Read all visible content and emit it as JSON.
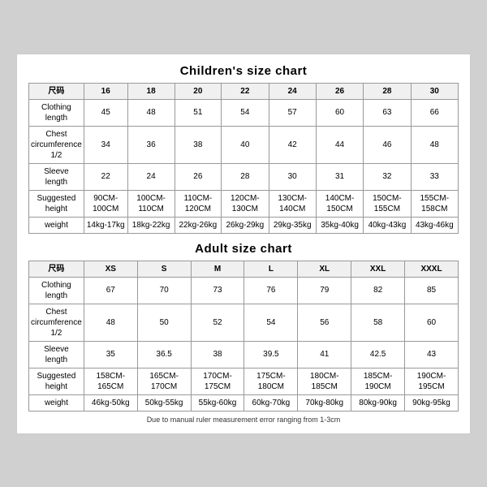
{
  "children_chart": {
    "title": "Children's size chart",
    "headers": [
      "尺码",
      "16",
      "18",
      "20",
      "22",
      "24",
      "26",
      "28",
      "30"
    ],
    "rows": [
      {
        "label": "Clothing\nlength",
        "values": [
          "45",
          "48",
          "51",
          "54",
          "57",
          "60",
          "63",
          "66"
        ]
      },
      {
        "label": "Chest\ncircumference\n1/2",
        "values": [
          "34",
          "36",
          "38",
          "40",
          "42",
          "44",
          "46",
          "48"
        ]
      },
      {
        "label": "Sleeve\nlength",
        "values": [
          "22",
          "24",
          "26",
          "28",
          "30",
          "31",
          "32",
          "33"
        ]
      },
      {
        "label": "Suggested\nheight",
        "values": [
          "90CM-100CM",
          "100CM-110CM",
          "110CM-120CM",
          "120CM-130CM",
          "130CM-140CM",
          "140CM-150CM",
          "150CM-155CM",
          "155CM-158CM"
        ]
      },
      {
        "label": "weight",
        "values": [
          "14kg-17kg",
          "18kg-22kg",
          "22kg-26kg",
          "26kg-29kg",
          "29kg-35kg",
          "35kg-40kg",
          "40kg-43kg",
          "43kg-46kg"
        ]
      }
    ]
  },
  "adult_chart": {
    "title": "Adult size chart",
    "headers": [
      "尺码",
      "XS",
      "S",
      "M",
      "L",
      "XL",
      "XXL",
      "XXXL"
    ],
    "rows": [
      {
        "label": "Clothing\nlength",
        "values": [
          "67",
          "70",
          "73",
          "76",
          "79",
          "82",
          "85"
        ]
      },
      {
        "label": "Chest\ncircumference\n1/2",
        "values": [
          "48",
          "50",
          "52",
          "54",
          "56",
          "58",
          "60"
        ]
      },
      {
        "label": "Sleeve\nlength",
        "values": [
          "35",
          "36.5",
          "38",
          "39.5",
          "41",
          "42.5",
          "43"
        ]
      },
      {
        "label": "Suggested\nheight",
        "values": [
          "158CM-165CM",
          "165CM-170CM",
          "170CM-175CM",
          "175CM-180CM",
          "180CM-185CM",
          "185CM-190CM",
          "190CM-195CM"
        ]
      },
      {
        "label": "weight",
        "values": [
          "46kg-50kg",
          "50kg-55kg",
          "55kg-60kg",
          "60kg-70kg",
          "70kg-80kg",
          "80kg-90kg",
          "90kg-95kg"
        ]
      }
    ]
  },
  "footer": {
    "note": "Due to manual ruler measurement error ranging from 1-3cm"
  }
}
